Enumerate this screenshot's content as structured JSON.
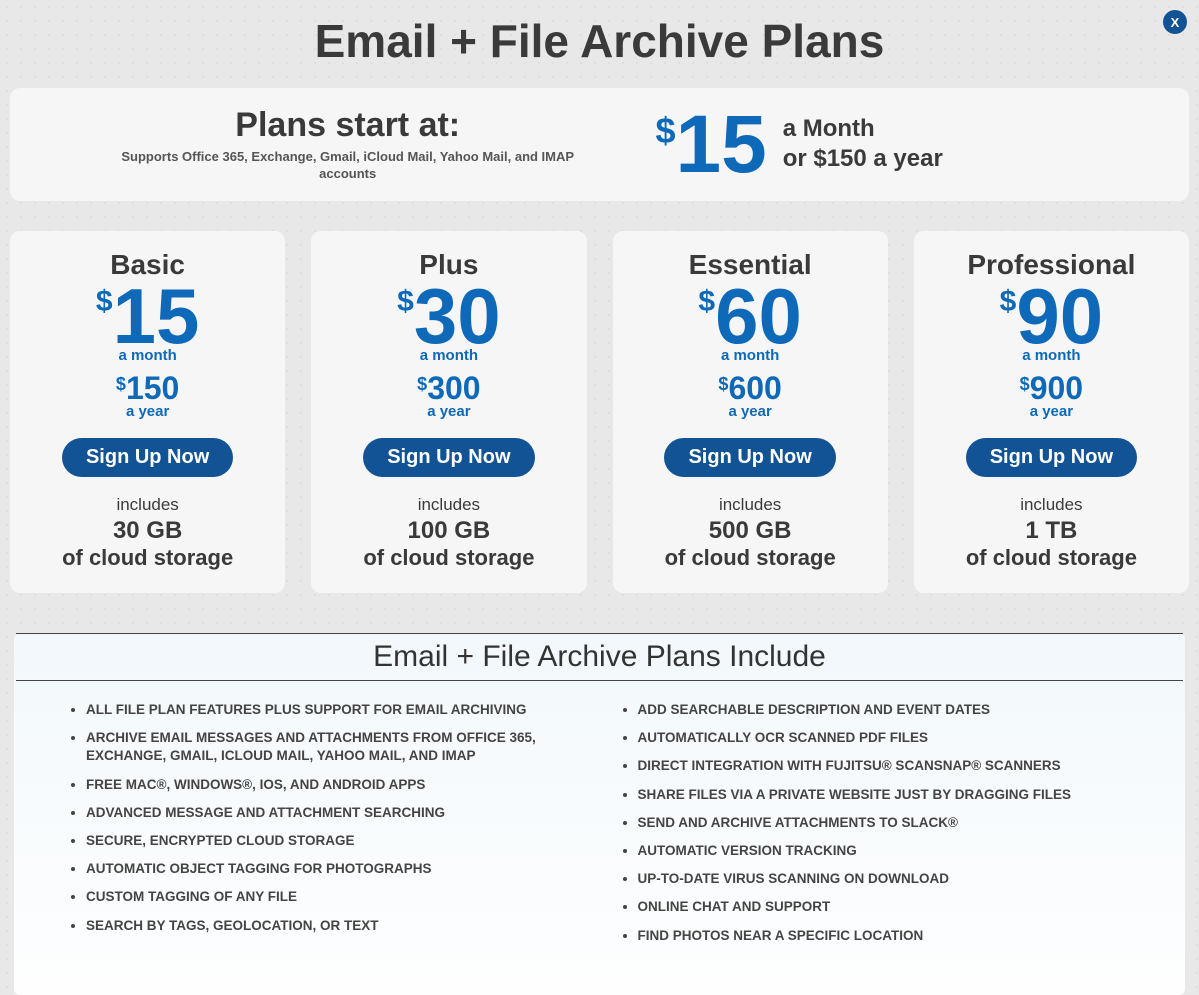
{
  "close_label": "X",
  "page_title": "Email + File Archive Plans",
  "hero": {
    "starts_at": "Plans start at:",
    "supports": "Supports Office 365, Exchange, Gmail, iCloud Mail, Yahoo Mail, and IMAP accounts",
    "currency": "$",
    "price": "15",
    "line1": "a Month",
    "line2": "or $150 a year"
  },
  "common": {
    "currency": "$",
    "a_month": "a month",
    "a_year": "a year",
    "signup": "Sign Up Now",
    "includes": "includes",
    "of_cloud_storage": "of cloud storage"
  },
  "plans": [
    {
      "name": "Basic",
      "monthly": "15",
      "yearly": "150",
      "storage": "30 GB"
    },
    {
      "name": "Plus",
      "monthly": "30",
      "yearly": "300",
      "storage": "100 GB"
    },
    {
      "name": "Essential",
      "monthly": "60",
      "yearly": "600",
      "storage": "500 GB"
    },
    {
      "name": "Professional",
      "monthly": "90",
      "yearly": "900",
      "storage": "1 TB"
    }
  ],
  "features": {
    "title": "Email + File Archive Plans Include",
    "left": [
      "ALL FILE PLAN FEATURES PLUS SUPPORT FOR EMAIL ARCHIVING",
      "ARCHIVE EMAIL MESSAGES AND ATTACHMENTS FROM OFFICE 365, EXCHANGE, GMAIL, ICLOUD MAIL, YAHOO MAIL, AND IMAP",
      "FREE MAC®, WINDOWS®, IOS, AND ANDROID APPS",
      "ADVANCED MESSAGE AND ATTACHMENT SEARCHING",
      "SECURE, ENCRYPTED CLOUD STORAGE",
      "AUTOMATIC OBJECT TAGGING FOR PHOTOGRAPHS",
      "CUSTOM TAGGING OF ANY FILE",
      "SEARCH BY TAGS, GEOLOCATION, OR TEXT"
    ],
    "right": [
      "ADD SEARCHABLE DESCRIPTION AND EVENT DATES",
      "AUTOMATICALLY OCR SCANNED PDF FILES",
      "DIRECT INTEGRATION WITH FUJITSU® SCANSNAP® SCANNERS",
      "SHARE FILES VIA A PRIVATE WEBSITE JUST BY DRAGGING FILES",
      "SEND AND ARCHIVE ATTACHMENTS TO SLACK®",
      "AUTOMATIC VERSION TRACKING",
      "UP-TO-DATE VIRUS SCANNING ON DOWNLOAD",
      "ONLINE CHAT AND SUPPORT",
      "FIND PHOTOS NEAR A SPECIFIC LOCATION"
    ]
  }
}
